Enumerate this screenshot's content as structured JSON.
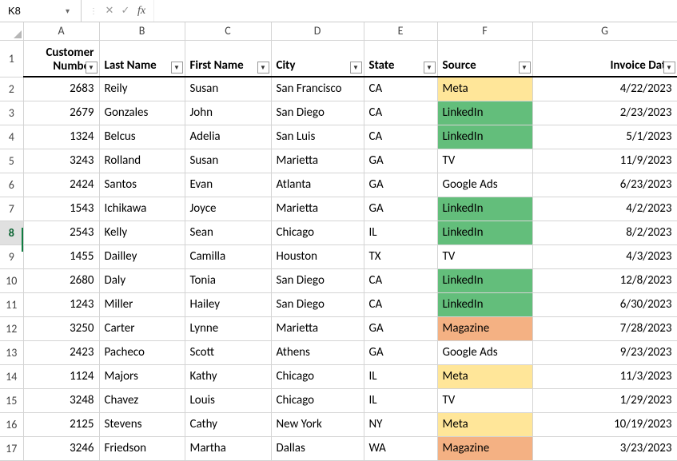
{
  "nameBox": {
    "value": "K8"
  },
  "formula": {
    "value": ""
  },
  "colLetters": [
    "A",
    "B",
    "C",
    "D",
    "E",
    "F",
    "G"
  ],
  "headers": {
    "A1": "Customer",
    "A2": "Number",
    "B": "Last Name",
    "C": "First Name",
    "D": "City",
    "E": "State",
    "F": "Source",
    "G": "Invoice Date"
  },
  "rows": [
    {
      "n": 2,
      "customer": "2683",
      "last": "Reily",
      "first": "Susan",
      "city": "San Francisco",
      "state": "CA",
      "source": "Meta",
      "srcClass": "src-meta",
      "invoice": "4/22/2023"
    },
    {
      "n": 3,
      "customer": "2679",
      "last": "Gonzales",
      "first": "John",
      "city": "San Diego",
      "state": "CA",
      "source": "LinkedIn",
      "srcClass": "src-linkedin",
      "invoice": "2/23/2023"
    },
    {
      "n": 4,
      "customer": "1324",
      "last": "Belcus",
      "first": "Adelia",
      "city": "San Luis",
      "state": "CA",
      "source": "LinkedIn",
      "srcClass": "src-linkedin",
      "invoice": "5/1/2023"
    },
    {
      "n": 5,
      "customer": "3243",
      "last": "Rolland",
      "first": "Susan",
      "city": "Marietta",
      "state": "GA",
      "source": "TV",
      "srcClass": "",
      "invoice": "11/9/2023"
    },
    {
      "n": 6,
      "customer": "2424",
      "last": "Santos",
      "first": "Evan",
      "city": "Atlanta",
      "state": "GA",
      "source": "Google Ads",
      "srcClass": "",
      "invoice": "6/23/2023"
    },
    {
      "n": 7,
      "customer": "1543",
      "last": "Ichikawa",
      "first": "Joyce",
      "city": "Marietta",
      "state": "GA",
      "source": "LinkedIn",
      "srcClass": "src-linkedin",
      "invoice": "4/2/2023"
    },
    {
      "n": 8,
      "customer": "2543",
      "last": "Kelly",
      "first": "Sean",
      "city": "Chicago",
      "state": "IL",
      "source": "LinkedIn",
      "srcClass": "src-linkedin",
      "invoice": "8/2/2023"
    },
    {
      "n": 9,
      "customer": "1455",
      "last": "Dailley",
      "first": "Camilla",
      "city": "Houston",
      "state": "TX",
      "source": "TV",
      "srcClass": "",
      "invoice": "4/3/2023"
    },
    {
      "n": 10,
      "customer": "2680",
      "last": "Daly",
      "first": "Tonia",
      "city": "San Diego",
      "state": "CA",
      "source": "LinkedIn",
      "srcClass": "src-linkedin",
      "invoice": "12/8/2023"
    },
    {
      "n": 11,
      "customer": "1243",
      "last": "Miller",
      "first": "Hailey",
      "city": "San Diego",
      "state": "CA",
      "source": "LinkedIn",
      "srcClass": "src-linkedin",
      "invoice": "6/30/2023"
    },
    {
      "n": 12,
      "customer": "3250",
      "last": "Carter",
      "first": "Lynne",
      "city": "Marietta",
      "state": "GA",
      "source": "Magazine",
      "srcClass": "src-magazine",
      "invoice": "7/28/2023"
    },
    {
      "n": 13,
      "customer": "2423",
      "last": "Pacheco",
      "first": "Scott",
      "city": "Athens",
      "state": "GA",
      "source": "Google Ads",
      "srcClass": "",
      "invoice": "9/23/2023"
    },
    {
      "n": 14,
      "customer": "1124",
      "last": "Majors",
      "first": "Kathy",
      "city": "Chicago",
      "state": "IL",
      "source": "Meta",
      "srcClass": "src-meta",
      "invoice": "11/3/2023"
    },
    {
      "n": 15,
      "customer": "3248",
      "last": "Chavez",
      "first": "Louis",
      "city": "Chicago",
      "state": "IL",
      "source": "TV",
      "srcClass": "",
      "invoice": "1/29/2023"
    },
    {
      "n": 16,
      "customer": "2125",
      "last": "Stevens",
      "first": "Cathy",
      "city": "New York",
      "state": "NY",
      "source": "Meta",
      "srcClass": "src-meta",
      "invoice": "10/19/2023"
    },
    {
      "n": 17,
      "customer": "3246",
      "last": "Friedson",
      "first": "Martha",
      "city": "Dallas",
      "state": "WA",
      "source": "Magazine",
      "srcClass": "src-magazine",
      "invoice": "3/23/2023"
    }
  ],
  "selectedRow": 8
}
